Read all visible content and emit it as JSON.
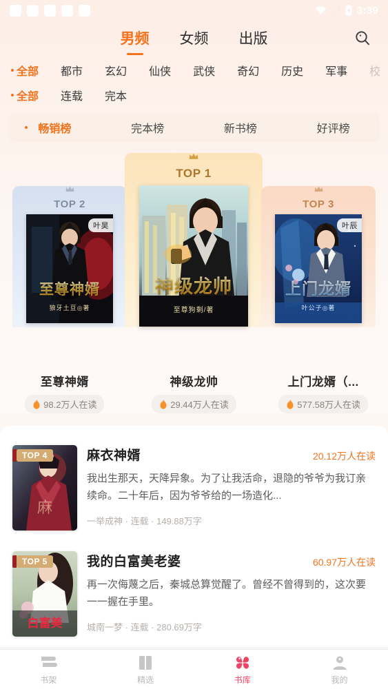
{
  "status_bar": {
    "placeholder_icon_count": 5,
    "icons": [
      "wifi-icon",
      "signal-off-icon",
      "battery-charging-icon"
    ],
    "time": "3:39"
  },
  "header": {
    "tabs": [
      {
        "label": "男频",
        "active": true
      },
      {
        "label": "女频",
        "active": false
      },
      {
        "label": "出版",
        "active": false
      }
    ],
    "search_icon": "search-icon",
    "accent_color": "#f5721d"
  },
  "filters": {
    "category_row": [
      {
        "label": "全部",
        "selected": true
      },
      {
        "label": "都市",
        "selected": false
      },
      {
        "label": "玄幻",
        "selected": false
      },
      {
        "label": "仙侠",
        "selected": false
      },
      {
        "label": "武侠",
        "selected": false
      },
      {
        "label": "奇幻",
        "selected": false
      },
      {
        "label": "历史",
        "selected": false
      },
      {
        "label": "军事",
        "selected": false
      },
      {
        "label": "校",
        "selected": false,
        "cut_off": true
      }
    ],
    "status_row": [
      {
        "label": "全部",
        "selected": true
      },
      {
        "label": "连载",
        "selected": false
      },
      {
        "label": "完本",
        "selected": false
      }
    ]
  },
  "rank_tabs": [
    {
      "label": "畅销榜",
      "selected": true
    },
    {
      "label": "完本榜",
      "selected": false
    },
    {
      "label": "新书榜",
      "selected": false
    },
    {
      "label": "好评榜",
      "selected": false
    }
  ],
  "podium": [
    {
      "rank_label": "TOP 2",
      "title": "至尊神婿",
      "hot": "98.2万人在读",
      "author_badge": "叶昊",
      "cover_title": "至尊神婿",
      "cover_author": "狼牙土豆◎著",
      "card_color": "#d5e0ef",
      "label_color": "#7f8da1"
    },
    {
      "rank_label": "TOP 1",
      "title": "神级龙帅",
      "hot": "29.44万人在读",
      "author_badge": "",
      "cover_title": "神级龙帅",
      "cover_author": "至尊狗剩/著",
      "card_color": "#fbe4bb",
      "label_color": "#a9762b"
    },
    {
      "rank_label": "TOP 3",
      "title": "上门龙婿（...",
      "hot": "577.58万人在读",
      "author_badge": "叶辰",
      "cover_title": "上门龙婿",
      "cover_author": "叶公子◎著",
      "card_color": "#fbd9c4",
      "label_color": "#c08553"
    }
  ],
  "list": [
    {
      "rank_label": "TOP 4",
      "title": "麻衣神婿",
      "hot": "20.12万人在读",
      "desc": "我出生那天，天降异象。为了让我活命，退隐的爷爷为我订亲续命。二十年后，因为爷爷给的一场造化...",
      "tags": "一举成神 · 连载 · 149.88万字",
      "cover_title": "麻衣神婿"
    },
    {
      "rank_label": "TOP 5",
      "title": "我的白富美老婆",
      "hot": "60.97万人在读",
      "desc": "再一次侮蔑之后，秦城总算觉醒了。曾经不曾得到的，这次要一一握在手里。",
      "tags": "城南一梦 · 连载 · 280.69万字",
      "cover_title": "我的白富美老婆"
    }
  ],
  "bottom_nav": [
    {
      "label": "书架",
      "icon": "bookshelf-icon",
      "active": false
    },
    {
      "label": "精选",
      "icon": "open-book-icon",
      "active": false
    },
    {
      "label": "书库",
      "icon": "clover-library-icon",
      "active": true
    },
    {
      "label": "我的",
      "icon": "user-profile-icon",
      "active": false
    }
  ],
  "theme": {
    "accent": "#f5721d",
    "nav_active": "#ef4565",
    "background": "#fdf7f4",
    "hot_pill_bg": "#f3efec"
  }
}
